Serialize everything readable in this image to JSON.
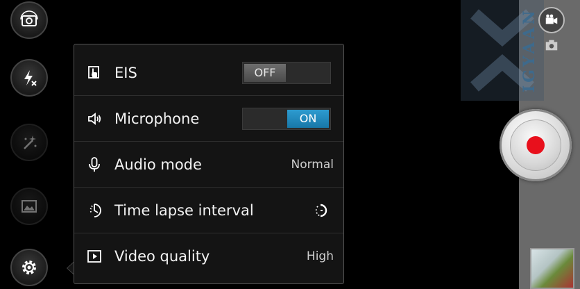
{
  "left_controls": [
    {
      "name": "switch-camera-icon"
    },
    {
      "name": "flash-off-icon"
    },
    {
      "name": "effects-icon"
    },
    {
      "name": "gallery-icon"
    },
    {
      "name": "settings-gear-icon"
    }
  ],
  "settings_panel": {
    "rows": [
      {
        "icon": "eis-hand-icon",
        "label": "EIS",
        "type": "toggle",
        "state": "OFF"
      },
      {
        "icon": "speaker-icon",
        "label": "Microphone",
        "type": "toggle",
        "state": "ON"
      },
      {
        "icon": "microphone-icon",
        "label": "Audio mode",
        "type": "value",
        "value": "Normal"
      },
      {
        "icon": "time-lapse-icon",
        "label": "Time lapse interval",
        "type": "icon-value"
      },
      {
        "icon": "video-play-icon",
        "label": "Video quality",
        "type": "value",
        "value": "High"
      }
    ]
  },
  "watermark": {
    "text": "IGYAAN",
    "url": "www.igyaan.in"
  },
  "colors": {
    "toggle_on": "#1d86bb",
    "record_dot": "#e8101c",
    "panel_bg": "#141414"
  }
}
